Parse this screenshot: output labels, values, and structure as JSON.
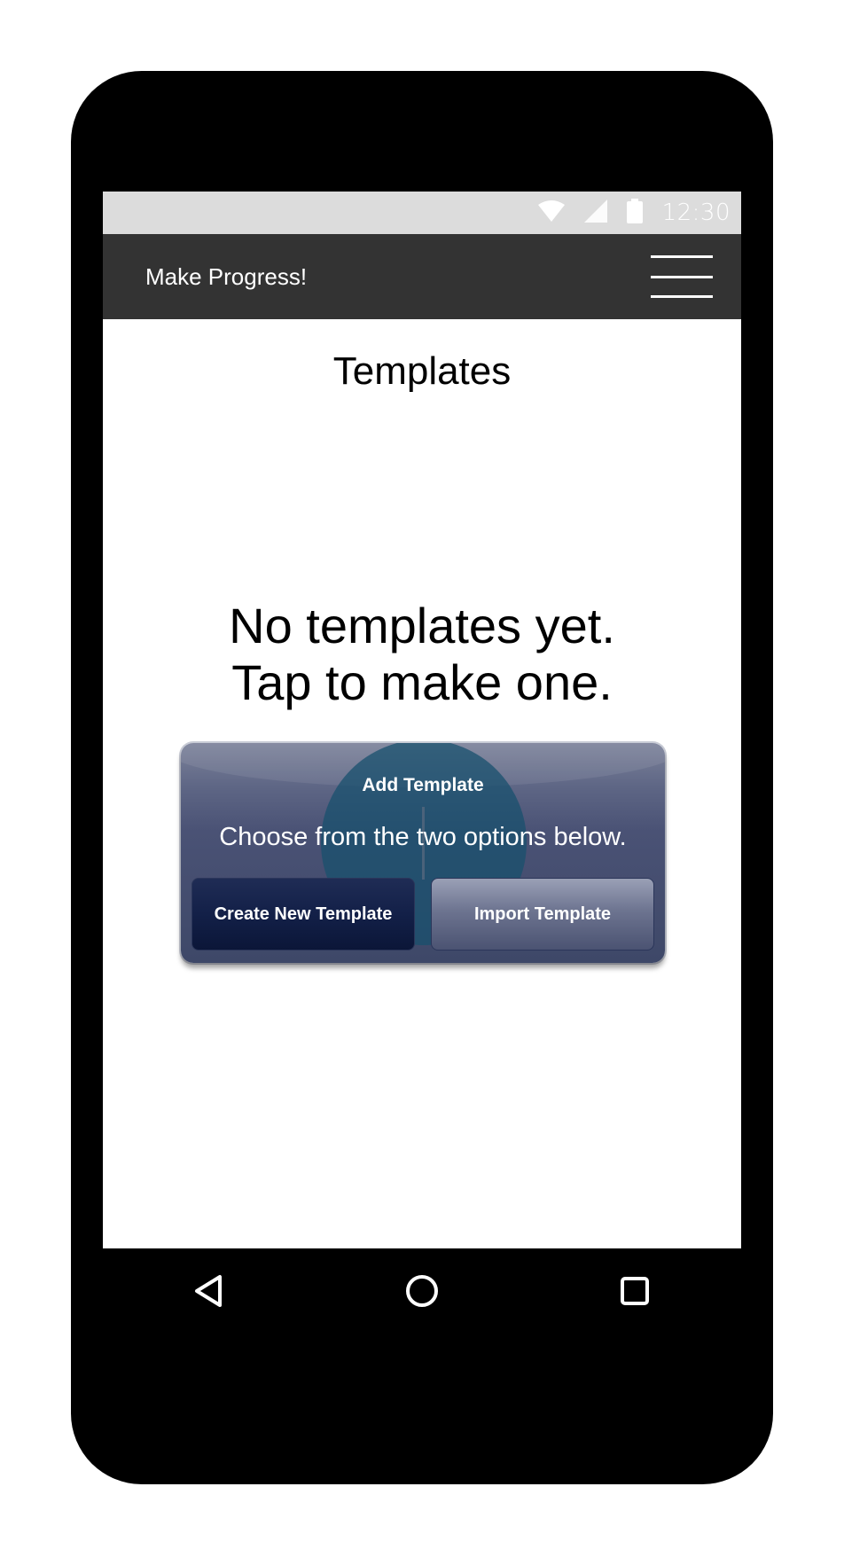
{
  "status_bar": {
    "time": "12:30",
    "icons": [
      "wifi-icon",
      "signal-icon",
      "battery-icon"
    ]
  },
  "app_bar": {
    "title": "Make Progress!",
    "menu_icon": "hamburger-menu-icon"
  },
  "page": {
    "title": "Templates",
    "empty_line1": "No templates yet.",
    "empty_line2": "Tap to make one."
  },
  "dialog": {
    "title": "Add Template",
    "message": "Choose from the two options below.",
    "create_label": "Create New Template",
    "import_label": "Import Template"
  },
  "nav_bar": {
    "icons": [
      "back-icon",
      "home-icon",
      "recents-icon"
    ]
  },
  "colors": {
    "app_bar": "#333333",
    "status_bar": "#dcdcdc",
    "dialog": "#3e4868",
    "create_button": "#132048",
    "device_frame": "#000000"
  }
}
